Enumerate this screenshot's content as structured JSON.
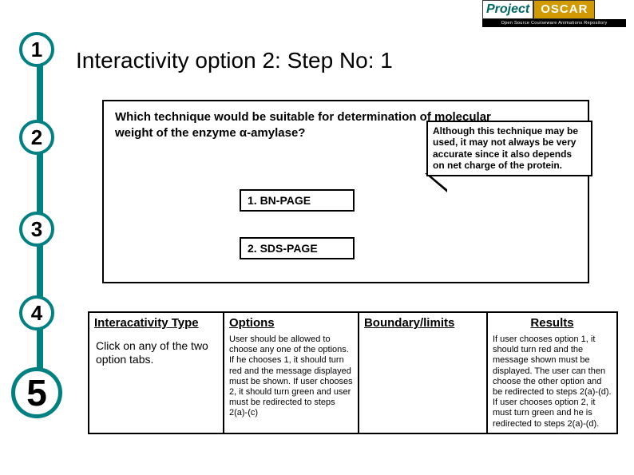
{
  "logo": {
    "brand_left": "Project",
    "brand_right": "OSCAR",
    "tagline": "Open Source Courseware Animations Repository"
  },
  "stepper": {
    "steps": [
      "1",
      "2",
      "3",
      "4",
      "5"
    ],
    "current": 5
  },
  "title": "Interactivity option 2: Step No: 1",
  "question": "Which technique would be suitable for determination of molecular weight of the enzyme α-amylase?",
  "callout": "Although this technique may be used, it may not always be very accurate since it also depends on net charge of the protein.",
  "options": [
    "1. BN-PAGE",
    "2. SDS-PAGE"
  ],
  "table": {
    "headers": [
      "Interacativity Type",
      "Options",
      "Boundary/limits",
      "Results"
    ],
    "cells": {
      "interactivity": "Click on any of the two option tabs.",
      "options_text": "User should be allowed to choose any one of the options. If he chooses 1, it should turn red and the message displayed must be shown. If user chooses 2, it should turn green and user must be redirected to steps 2(a)-(c)",
      "boundary": "",
      "results": "If user chooses option 1, it should turn red and the message shown must be displayed. The user can then choose the other option and be redirected to steps 2(a)-(d). If user chooses option 2, it must turn green and he is redirected to steps 2(a)-(d)."
    }
  }
}
